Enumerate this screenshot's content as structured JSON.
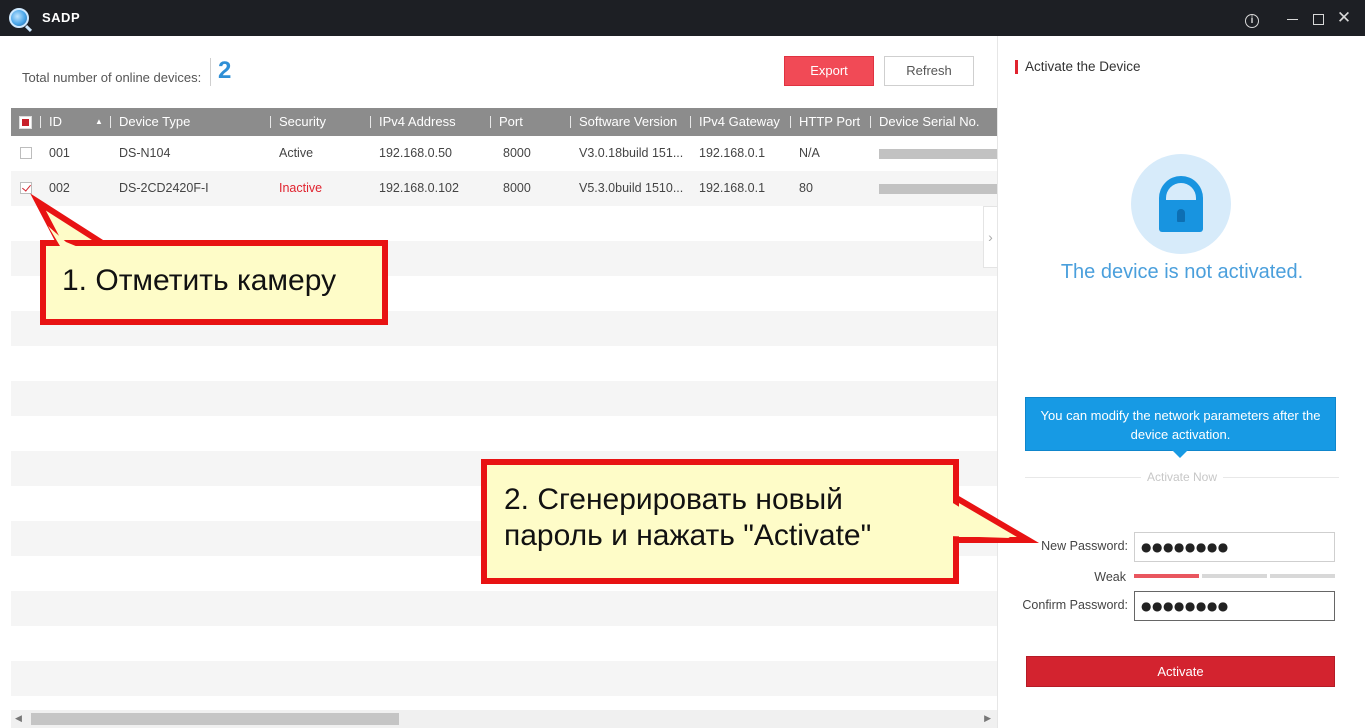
{
  "window": {
    "title": "SADP"
  },
  "toolbar": {
    "total_label": "Total number of online devices:",
    "total_count": "2",
    "export_label": "Export",
    "refresh_label": "Refresh"
  },
  "table": {
    "columns": [
      "ID",
      "Device Type",
      "Security",
      "IPv4 Address",
      "Port",
      "Software Version",
      "IPv4 Gateway",
      "HTTP Port",
      "Device Serial No."
    ],
    "rows": [
      {
        "checked": false,
        "id": "001",
        "device_type": "DS-N104",
        "security": "Active",
        "ipv4": "192.168.0.50",
        "port": "8000",
        "software": "V3.0.18build 151...",
        "gateway": "192.168.0.1",
        "http_port": "N/A"
      },
      {
        "checked": true,
        "id": "002",
        "device_type": "DS-2CD2420F-I",
        "security": "Inactive",
        "ipv4": "192.168.0.102",
        "port": "8000",
        "software": "V5.3.0build 1510...",
        "gateway": "192.168.0.1",
        "http_port": "80"
      }
    ]
  },
  "panel": {
    "title": "Activate the Device",
    "status": "The device is not activated.",
    "tooltip": "You can modify the network parameters after the device activation.",
    "activate_now": "Activate Now",
    "new_password_label": "New Password:",
    "new_password_value": "●●●●●●●●",
    "strength_label": "Weak",
    "strength_level": 1,
    "strength_max": 3,
    "confirm_password_label": "Confirm Password:",
    "confirm_password_value": "●●●●●●●●",
    "activate_label": "Activate"
  },
  "annotations": {
    "step1": "1. Отметить камеру",
    "step2": "2. Сгенерировать новый пароль и нажать \"Activate\""
  },
  "colors": {
    "accent_red": "#d3232f",
    "accent_blue": "#179ae4",
    "header_gray": "#8c8c8c",
    "titlebar": "#1d1f24",
    "callout_border": "#e81313",
    "callout_fill": "#fefcc8",
    "strength_weak": "#e9565f"
  }
}
